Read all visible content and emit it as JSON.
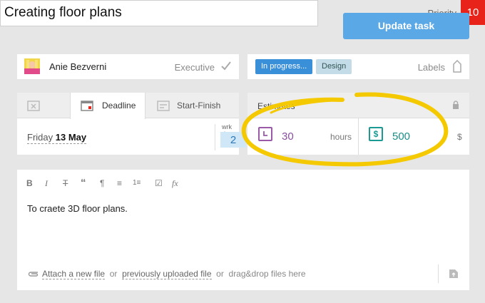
{
  "task": {
    "title": "Creating floor plans",
    "priority_label": "Priority",
    "priority_value": "10",
    "update_button": "Update task"
  },
  "assignee": {
    "name": "Anie Bezverni",
    "role": "Executive"
  },
  "labels": {
    "tags": [
      "In progress...",
      "Design"
    ],
    "label_text": "Labels"
  },
  "deadline": {
    "tabs": [
      {
        "label": "",
        "icon": "no-date-icon"
      },
      {
        "label": "Deadline",
        "icon": "calendar-icon"
      },
      {
        "label": "Start-Finish",
        "icon": "range-icon"
      }
    ],
    "weekday": "Friday",
    "date": "13 May",
    "work_day_label": "wrk day",
    "work_day_value": "2"
  },
  "estimates": {
    "title": "Estimates",
    "hours_value": "30",
    "hours_unit": "hours",
    "cost_symbol": "$",
    "cost_value": "500",
    "cost_unit": "$"
  },
  "editor": {
    "toolbar": [
      "B",
      "I",
      "T",
      "“",
      "¶",
      "≡",
      "1≡",
      "☑",
      "fx"
    ],
    "content": "To craete 3D floor plans.",
    "attach_link": "Attach a new file",
    "or1": "or",
    "previous_link": "previously uploaded file",
    "or2": "or",
    "drag_text": "drag&drop files here"
  },
  "colors": {
    "priority": "#e8231a",
    "button": "#5aa8e6",
    "tag_progress": "#3a8fd9",
    "tag_design": "#c4dce8",
    "hours": "#8a4fa0",
    "cost": "#1a8e88",
    "highlight": "#f5c900"
  }
}
